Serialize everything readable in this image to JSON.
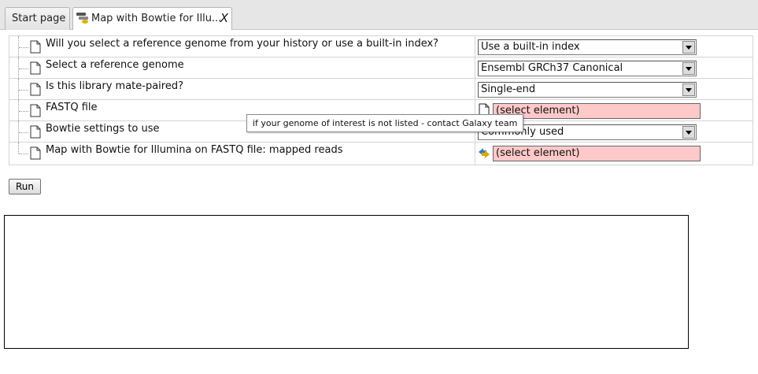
{
  "tabs": [
    {
      "label": "Start page",
      "active": false
    },
    {
      "label": "Map with Bowtie for Illu...",
      "active": true,
      "close": "X"
    }
  ],
  "params": [
    {
      "label": "Will you select a reference genome from your history or use a built-in index?",
      "type": "select",
      "value": "Use a built-in index"
    },
    {
      "label": "Select a reference genome",
      "type": "select",
      "value": "Ensembl GRCh37 Canonical"
    },
    {
      "label": "Is this library mate-paired?",
      "type": "select",
      "value": "Single-end"
    },
    {
      "label": "FASTQ file",
      "type": "element",
      "value": "(select element)",
      "icon": "document-icon"
    },
    {
      "label": "Bowtie settings to use",
      "type": "select",
      "value": "Commonly used"
    },
    {
      "label": "Map with Bowtie for Illumina on FASTQ file: mapped reads",
      "type": "element",
      "value": "(select element)",
      "icon": "connection-icon"
    }
  ],
  "run_label": "Run",
  "tooltip": "if your genome of interest is not listed - contact Galaxy team",
  "colors": {
    "invalid_field": "#ffc9c9"
  }
}
